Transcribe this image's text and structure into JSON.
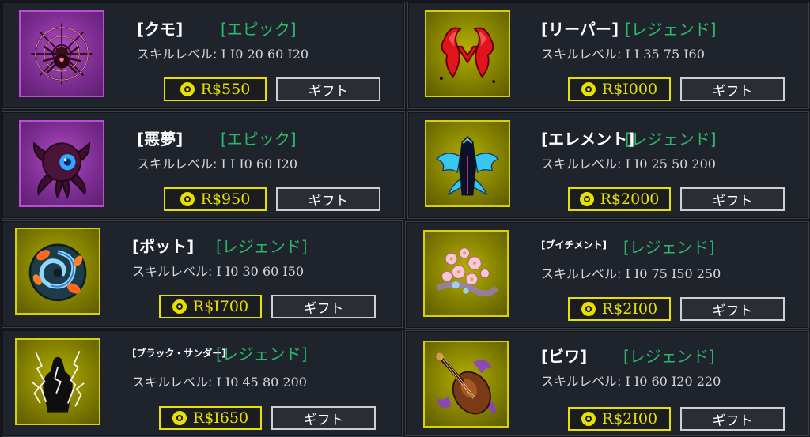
{
  "skill_label": "スキルレベル:",
  "gift_label": "ギフト",
  "items": [
    {
      "name": "[クモ]",
      "rarity": "[エピック]",
      "levels": "I I0 20 60 I20",
      "price": "R$550"
    },
    {
      "name": "[悪夢]",
      "rarity": "[エピック]",
      "levels": "I I I0 60 I20",
      "price": "R$950"
    },
    {
      "name": "[ポット]",
      "rarity": "[レジェンド]",
      "levels": "I I0 30 60 I50",
      "price": "R$I700"
    },
    {
      "name": "[ブラック・サンダー]",
      "rarity": "[レジェンド]",
      "levels": "I I0 45 80 200",
      "price": "R$I650"
    },
    {
      "name": "[リーパー]",
      "rarity": "[レジェンド]",
      "levels": "I I 35 75 I60",
      "price": "R$I000"
    },
    {
      "name": "[エレメント]",
      "rarity": "[レジェンド]",
      "levels": "I I0 25 50 200",
      "price": "R$2000"
    },
    {
      "name": "[ブイチメント]",
      "rarity": "[レジェンド]",
      "levels": "I I0 75 I50 250",
      "price": "R$2I00"
    },
    {
      "name": "[ビワ]",
      "rarity": "[レジェンド]",
      "levels": "I I0 60 I20 220",
      "price": "R$2I00"
    }
  ],
  "icons": [
    "spider-icon",
    "nightmare-eye-icon",
    "koi-pot-icon",
    "black-thunder-icon",
    "reaper-icon",
    "element-icon",
    "blossom-icon",
    "biwa-icon"
  ],
  "colors": {
    "epic_border": "#c04bd6",
    "legend_border": "#d8d200",
    "rarity_text": "#2bb96a",
    "price_text": "#e8e000"
  }
}
